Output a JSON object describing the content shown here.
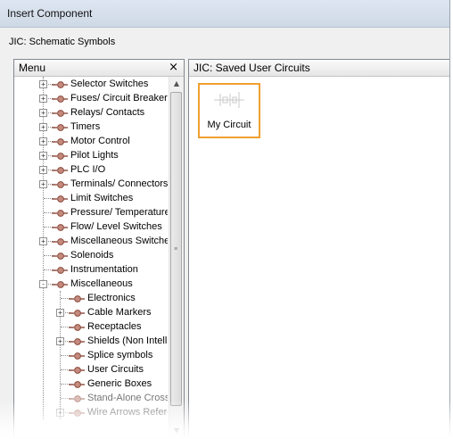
{
  "window": {
    "title": "Insert Component"
  },
  "library": {
    "label": "JIC: Schematic Symbols"
  },
  "menu_panel": {
    "title": "Menu",
    "close_glyph": "×",
    "items": [
      {
        "label": "Selector Switches",
        "level": 0,
        "expander": "+"
      },
      {
        "label": "Fuses/ Circuit Breakers",
        "level": 0,
        "expander": "+"
      },
      {
        "label": "Relays/ Contacts",
        "level": 0,
        "expander": "+"
      },
      {
        "label": "Timers",
        "level": 0,
        "expander": "+"
      },
      {
        "label": "Motor Control",
        "level": 0,
        "expander": "+"
      },
      {
        "label": "Pilot Lights",
        "level": 0,
        "expander": "+"
      },
      {
        "label": "PLC I/O",
        "level": 0,
        "expander": "+"
      },
      {
        "label": "Terminals/ Connectors",
        "level": 0,
        "expander": "+"
      },
      {
        "label": "Limit Switches",
        "level": 0,
        "expander": ""
      },
      {
        "label": "Pressure/ Temperature",
        "level": 0,
        "expander": ""
      },
      {
        "label": "Flow/ Level Switches",
        "level": 0,
        "expander": ""
      },
      {
        "label": "Miscellaneous Switches",
        "level": 0,
        "expander": "+"
      },
      {
        "label": "Solenoids",
        "level": 0,
        "expander": ""
      },
      {
        "label": "Instrumentation",
        "level": 0,
        "expander": ""
      },
      {
        "label": "Miscellaneous",
        "level": 0,
        "expander": "−"
      },
      {
        "label": "Electronics",
        "level": 1,
        "expander": ""
      },
      {
        "label": "Cable Markers",
        "level": 1,
        "expander": "+"
      },
      {
        "label": "Receptacles",
        "level": 1,
        "expander": ""
      },
      {
        "label": "Shields (Non Intelligent)",
        "level": 1,
        "expander": "+"
      },
      {
        "label": "Splice symbols",
        "level": 1,
        "expander": ""
      },
      {
        "label": "User Circuits",
        "level": 1,
        "expander": ""
      },
      {
        "label": "Generic Boxes",
        "level": 1,
        "expander": ""
      },
      {
        "label": "Stand-Alone Cross-",
        "level": 1,
        "expander": ""
      },
      {
        "label": "Wire Arrows Refere",
        "level": 1,
        "expander": "+"
      }
    ]
  },
  "content_panel": {
    "title": "JIC: Saved User Circuits",
    "items": [
      {
        "label": "My Circuit"
      }
    ]
  },
  "colors": {
    "selection_border": "#f0a030",
    "icon_brown": "#8b4a3c"
  }
}
